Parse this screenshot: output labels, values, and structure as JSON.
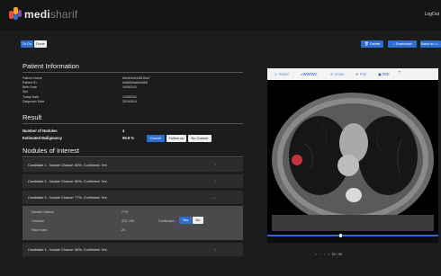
{
  "app": {
    "brand_bold": "medi",
    "brand_light": "sharif",
    "logout": "LogOut"
  },
  "toolbar": {
    "todo_label": "To Do",
    "done_label": "Done",
    "delete_label": "Delete",
    "download_label": "Download",
    "back_label": "Back to Li..."
  },
  "patient": {
    "title": "Patient Information",
    "fields": [
      {
        "label": "Patient Name",
        "value": "b8cfe4eb448156a7"
      },
      {
        "label": "Patient ID",
        "value": "f4dbff49a8fe8db5"
      },
      {
        "label": "Birth Date",
        "value": "19350101"
      },
      {
        "label": "Sex",
        "value": ""
      },
      {
        "label": "Today Date",
        "value": "19350101"
      },
      {
        "label": "Diagnosis Date",
        "value": "20190614"
      }
    ]
  },
  "result": {
    "title": "Result",
    "nodules_label": "Number of Nodules",
    "nodules_value": "4",
    "malignancy_label": "Estimated Malignancy",
    "malignancy_value": "99.8 %",
    "btn_cancer": "Cancer",
    "btn_followup": "Follow up",
    "btn_nocancer": "No Cancer"
  },
  "nodules": {
    "title": "Nodules of Interest",
    "candidates": [
      {
        "label": "Candidate 1 - Nodule Chance: 83%,  Confirmed: Yes",
        "chevron": "›"
      },
      {
        "label": "Candidate 2 - Nodule Chance: 80%,  Confirmed: Yes",
        "chevron": "›"
      },
      {
        "label": "Candidate 3 - Nodule Chance: 77%,  Confirmed: Yes",
        "chevron": "⌄"
      },
      {
        "label": "Candidate 4 - Nodule Chance: 96%,  Confirmed: Yes",
        "chevron": "›"
      }
    ],
    "detail": {
      "chance_label": "Nodule Chance",
      "chance_value": "77%",
      "centroid_label": "Centroid",
      "centroid_value": "372, 230",
      "slice_label": "Slice index",
      "slice_value": "20",
      "confirmed_label": "Confirmed:",
      "yes": "Yes",
      "no": "No"
    }
  },
  "viewer": {
    "reset": "Reset",
    "wwwc": "WW/WC",
    "zoom": "Zoom",
    "pan": "Pan",
    "roi": "ROI",
    "add": "+",
    "pager_label": "32 / 90"
  },
  "colors": {
    "accent": "#2d6ed3",
    "nodule": "#e03a4a"
  }
}
